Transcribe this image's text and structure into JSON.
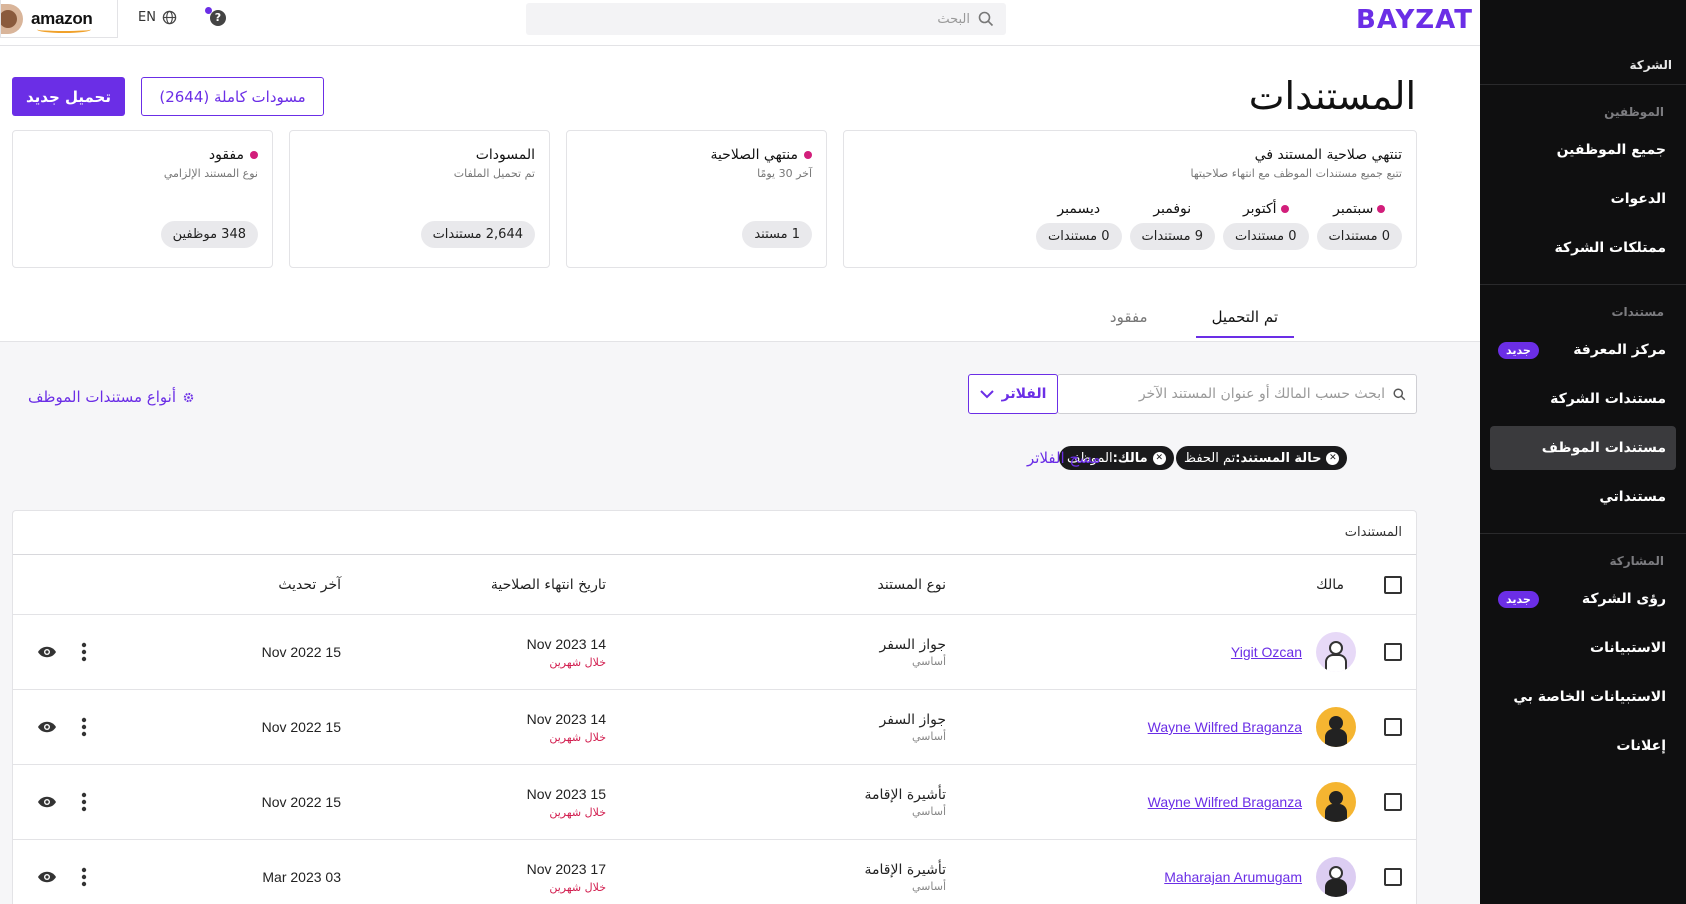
{
  "topbar": {
    "account_name": "amazon",
    "language": "EN",
    "help_symbol": "?",
    "search_placeholder": "البحث",
    "logo": "BAYZAT"
  },
  "sidebar": {
    "company_label": "الشركة",
    "sections": [
      {
        "title": "الموظفين",
        "items": [
          {
            "label": "جميع الموظفين",
            "badge": "",
            "active": false
          },
          {
            "label": "الدعوات",
            "badge": "",
            "active": false
          },
          {
            "label": "ممتلكات الشركة",
            "badge": "",
            "active": false
          }
        ]
      },
      {
        "title": "مستندات",
        "items": [
          {
            "label": "مركز المعرفة",
            "badge": "جديد",
            "active": false
          },
          {
            "label": "مستندات الشركة",
            "badge": "",
            "active": false
          },
          {
            "label": "مستندات الموظف",
            "badge": "",
            "active": true
          },
          {
            "label": "مستنداتي",
            "badge": "",
            "active": false
          }
        ]
      },
      {
        "title": "المشاركة",
        "items": [
          {
            "label": "رؤى الشركة",
            "badge": "جديد",
            "active": false
          },
          {
            "label": "الاستبيانات",
            "badge": "",
            "active": false
          },
          {
            "label": "الاستبيانات الخاصة بي",
            "badge": "",
            "active": false
          },
          {
            "label": "إعلانات",
            "badge": "",
            "active": false
          }
        ]
      }
    ]
  },
  "header": {
    "title": "المستندات",
    "upload_label": "تحميل جديد",
    "drafts_label": "مسودات كاملة (2644)"
  },
  "cards": {
    "expiry": {
      "title": "تنتهي صلاحية المستند في",
      "subtitle": "تتبع جميع مستندات الموظف مع انتهاء صلاحيتها",
      "months": [
        {
          "name": "سبتمبر",
          "count": "0 مستندات",
          "dot": true
        },
        {
          "name": "أكتوبر",
          "count": "0 مستندات",
          "dot": true
        },
        {
          "name": "نوفمبر",
          "count": "9 مستندات",
          "dot": false
        },
        {
          "name": "ديسمبر",
          "count": "0 مستندات",
          "dot": false
        }
      ]
    },
    "expired": {
      "title": "منتهي الصلاحية",
      "subtitle": "آخر 30 يومًا",
      "chip": "1 مستند"
    },
    "drafts": {
      "title": "المسودات",
      "subtitle": "تم تحميل الملفات",
      "chip": "2,644 مستندات"
    },
    "missing": {
      "title": "مفقود",
      "subtitle": "نوع المستند الإلزامي",
      "chip": "348 موظفين"
    }
  },
  "tabs": [
    {
      "label": "تم التحميل",
      "active": true
    },
    {
      "label": "مفقود",
      "active": false
    }
  ],
  "filters": {
    "search_placeholder": "ابحث حسب المالك أو عنوان المستند الآخر",
    "filter_button": "الفلاتر",
    "doc_types_link": "أنواع مستندات الموظف",
    "pills": [
      {
        "key": "حالة المستند:",
        "value": "تم الحفظ"
      },
      {
        "key": "مالك:",
        "value": "الموظف"
      }
    ],
    "clear_label": "مسح الفلاتر"
  },
  "table": {
    "caption": "المستندات",
    "headers": {
      "owner": "مالك",
      "type": "نوع المستند",
      "expiry": "تاريخ انتهاء الصلاحية",
      "updated": "آخر تحديث"
    },
    "rows": [
      {
        "owner": "Yigit Ozcan",
        "avatar_color": "#e7d9f7",
        "type": "جواز السفر",
        "type_sub": "أساسي",
        "expiry": "14 Nov 2023",
        "expiry_note": "خلال شهرين",
        "updated": "15 Nov 2022"
      },
      {
        "owner": "Wayne Wilfred Braganza",
        "avatar_color": "#f5b531",
        "type": "جواز السفر",
        "type_sub": "أساسي",
        "expiry": "14 Nov 2023",
        "expiry_note": "خلال شهرين",
        "updated": "15 Nov 2022"
      },
      {
        "owner": "Wayne Wilfred Braganza",
        "avatar_color": "#f5b531",
        "type": "تأشيرة الإقامة",
        "type_sub": "أساسي",
        "expiry": "15 Nov 2023",
        "expiry_note": "خلال شهرين",
        "updated": "15 Nov 2022"
      },
      {
        "owner": "Maharajan Arumugam",
        "avatar_color": "#dccdf2",
        "type": "تأشيرة الإقامة",
        "type_sub": "أساسي",
        "expiry": "17 Nov 2023",
        "expiry_note": "خلال شهرين",
        "updated": "03 Mar 2023"
      }
    ]
  },
  "colors": {
    "brand": "#6b2ee6",
    "alert": "#d21e7b",
    "sidebar_bg": "#0f0f10"
  }
}
